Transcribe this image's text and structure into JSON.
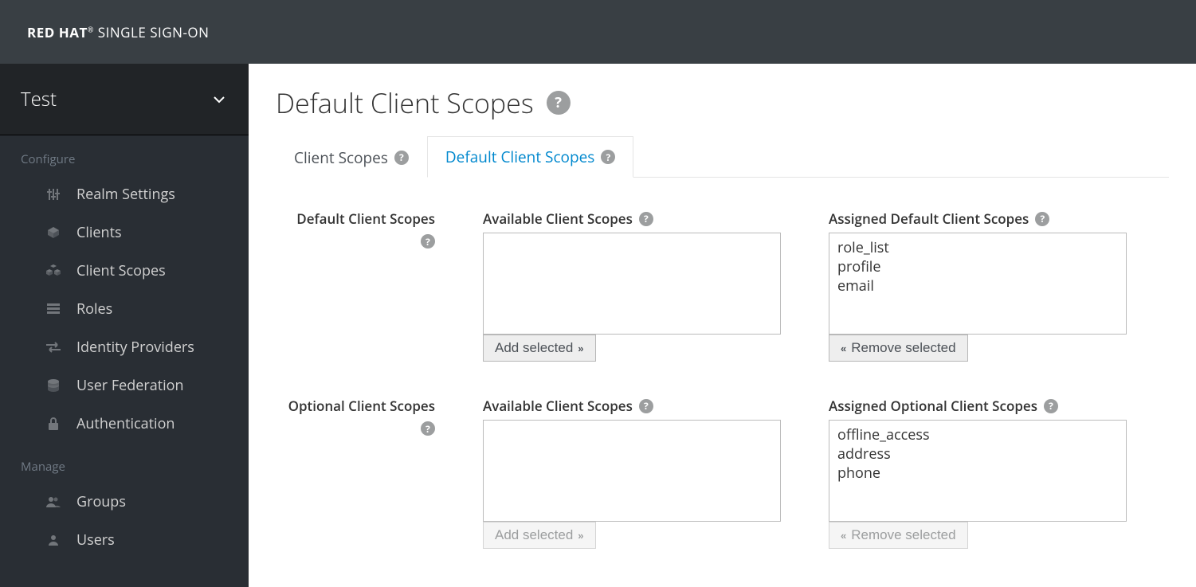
{
  "brand": {
    "line1": "RED HAT",
    "line2": "SINGLE SIGN-ON"
  },
  "realm": {
    "name": "Test"
  },
  "sidebar": {
    "section_configure": "Configure",
    "section_manage": "Manage",
    "items_configure": [
      {
        "label": "Realm Settings"
      },
      {
        "label": "Clients"
      },
      {
        "label": "Client Scopes"
      },
      {
        "label": "Roles"
      },
      {
        "label": "Identity Providers"
      },
      {
        "label": "User Federation"
      },
      {
        "label": "Authentication"
      }
    ],
    "items_manage": [
      {
        "label": "Groups"
      },
      {
        "label": "Users"
      }
    ]
  },
  "page": {
    "title": "Default Client Scopes"
  },
  "tabs": [
    {
      "label": "Client Scopes",
      "active": false
    },
    {
      "label": "Default Client Scopes",
      "active": true
    }
  ],
  "sections": {
    "default": {
      "row_label": "Default Client Scopes",
      "available_label": "Available Client Scopes",
      "assigned_label": "Assigned Default Client Scopes",
      "available_items": [],
      "assigned_items": [
        "role_list",
        "profile",
        "email"
      ],
      "add_label": "Add selected",
      "remove_label": "Remove selected",
      "add_disabled": false,
      "remove_disabled": false
    },
    "optional": {
      "row_label": "Optional Client Scopes",
      "available_label": "Available Client Scopes",
      "assigned_label": "Assigned Optional Client Scopes",
      "available_items": [],
      "assigned_items": [
        "offline_access",
        "address",
        "phone"
      ],
      "add_label": "Add selected",
      "remove_label": "Remove selected",
      "add_disabled": true,
      "remove_disabled": true
    }
  }
}
